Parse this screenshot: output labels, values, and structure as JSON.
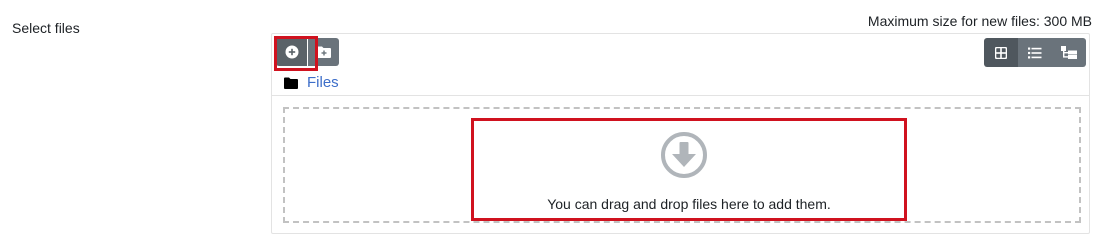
{
  "field": {
    "label": "Select files"
  },
  "limits": {
    "max_size_text": "Maximum size for new files: 300 MB"
  },
  "toolbar": {
    "add_icon": "plus-circle-icon",
    "create_folder_icon": "folder-plus-icon",
    "views": [
      {
        "icon": "grid-icon",
        "active": true
      },
      {
        "icon": "list-icon",
        "active": false
      },
      {
        "icon": "tree-icon",
        "active": false
      }
    ]
  },
  "path": {
    "folder_icon": "folder-icon",
    "label": "Files"
  },
  "dropzone": {
    "icon": "download-arrow-icon",
    "text": "You can drag and drop files here to add them."
  },
  "colors": {
    "highlight": "#d0121f",
    "link": "#3d6ec9",
    "button": "#6a737b"
  }
}
